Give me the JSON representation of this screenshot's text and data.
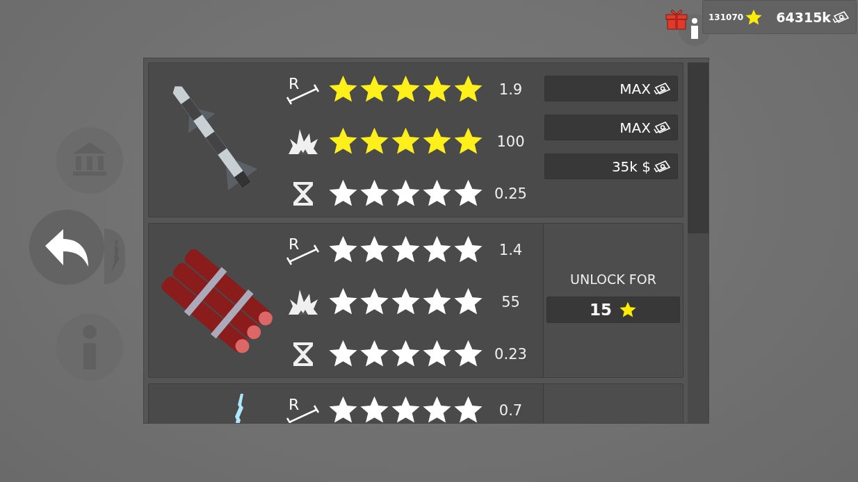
{
  "hud": {
    "star_total": "131070",
    "cash": "64315k"
  },
  "cards": [
    {
      "kind": "missile",
      "stats": [
        {
          "kind": "range",
          "icon_text": "R",
          "stars": 5,
          "maxed": true,
          "value": "1.9"
        },
        {
          "kind": "damage",
          "stars": 5,
          "maxed": true,
          "value": "100"
        },
        {
          "kind": "cooldown",
          "stars": 5,
          "maxed": false,
          "value": "0.25"
        }
      ],
      "upgrades": [
        {
          "label": "MAX"
        },
        {
          "label": "MAX"
        },
        {
          "label": "35k $"
        }
      ]
    },
    {
      "kind": "dynamite",
      "stats": [
        {
          "kind": "range",
          "icon_text": "R",
          "stars": 5,
          "maxed": false,
          "value": "1.4"
        },
        {
          "kind": "damage",
          "stars": 5,
          "maxed": false,
          "value": "55"
        },
        {
          "kind": "cooldown",
          "stars": 5,
          "maxed": false,
          "value": "0.23"
        }
      ],
      "unlock": {
        "label": "UNLOCK FOR",
        "price": "15"
      }
    },
    {
      "kind": "lightning",
      "stats": [
        {
          "kind": "range",
          "icon_text": "R",
          "stars": 5,
          "maxed": false,
          "value": "0.7"
        }
      ]
    }
  ]
}
